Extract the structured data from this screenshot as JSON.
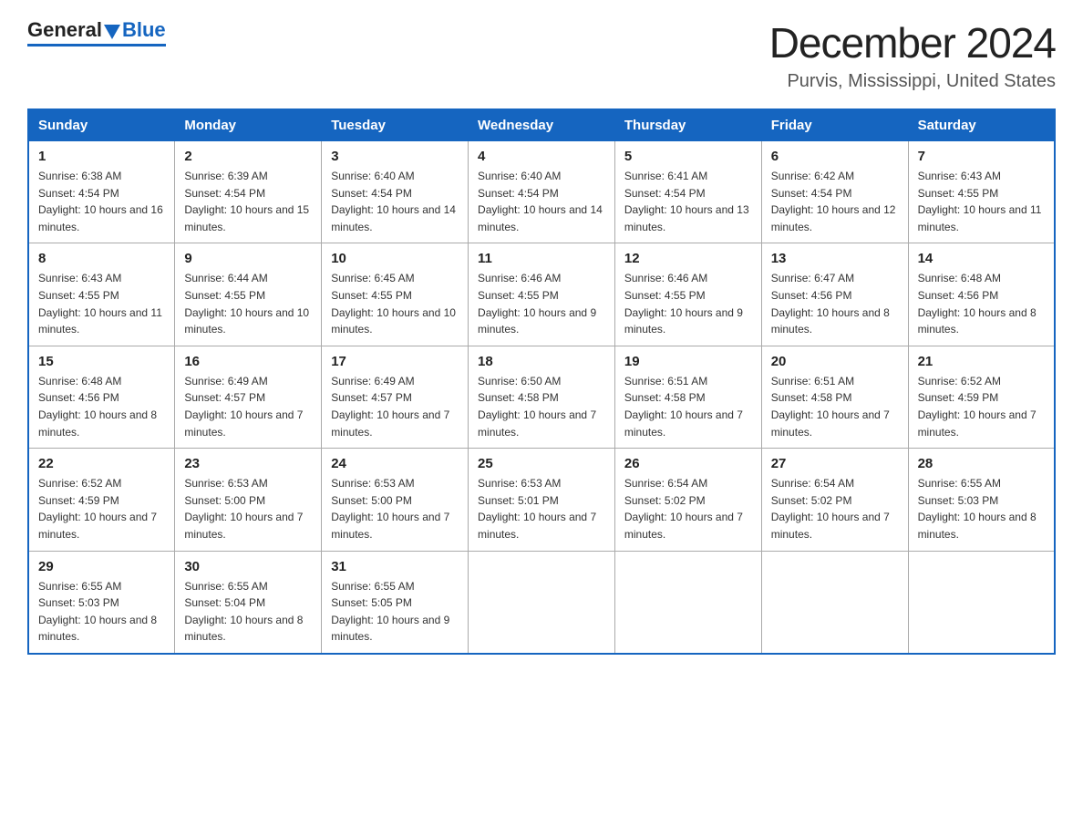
{
  "header": {
    "logo_general": "General",
    "logo_blue": "Blue",
    "month_title": "December 2024",
    "location": "Purvis, Mississippi, United States"
  },
  "days_of_week": [
    "Sunday",
    "Monday",
    "Tuesday",
    "Wednesday",
    "Thursday",
    "Friday",
    "Saturday"
  ],
  "weeks": [
    [
      {
        "day": "1",
        "sunrise": "6:38 AM",
        "sunset": "4:54 PM",
        "daylight": "10 hours and 16 minutes."
      },
      {
        "day": "2",
        "sunrise": "6:39 AM",
        "sunset": "4:54 PM",
        "daylight": "10 hours and 15 minutes."
      },
      {
        "day": "3",
        "sunrise": "6:40 AM",
        "sunset": "4:54 PM",
        "daylight": "10 hours and 14 minutes."
      },
      {
        "day": "4",
        "sunrise": "6:40 AM",
        "sunset": "4:54 PM",
        "daylight": "10 hours and 14 minutes."
      },
      {
        "day": "5",
        "sunrise": "6:41 AM",
        "sunset": "4:54 PM",
        "daylight": "10 hours and 13 minutes."
      },
      {
        "day": "6",
        "sunrise": "6:42 AM",
        "sunset": "4:54 PM",
        "daylight": "10 hours and 12 minutes."
      },
      {
        "day": "7",
        "sunrise": "6:43 AM",
        "sunset": "4:55 PM",
        "daylight": "10 hours and 11 minutes."
      }
    ],
    [
      {
        "day": "8",
        "sunrise": "6:43 AM",
        "sunset": "4:55 PM",
        "daylight": "10 hours and 11 minutes."
      },
      {
        "day": "9",
        "sunrise": "6:44 AM",
        "sunset": "4:55 PM",
        "daylight": "10 hours and 10 minutes."
      },
      {
        "day": "10",
        "sunrise": "6:45 AM",
        "sunset": "4:55 PM",
        "daylight": "10 hours and 10 minutes."
      },
      {
        "day": "11",
        "sunrise": "6:46 AM",
        "sunset": "4:55 PM",
        "daylight": "10 hours and 9 minutes."
      },
      {
        "day": "12",
        "sunrise": "6:46 AM",
        "sunset": "4:55 PM",
        "daylight": "10 hours and 9 minutes."
      },
      {
        "day": "13",
        "sunrise": "6:47 AM",
        "sunset": "4:56 PM",
        "daylight": "10 hours and 8 minutes."
      },
      {
        "day": "14",
        "sunrise": "6:48 AM",
        "sunset": "4:56 PM",
        "daylight": "10 hours and 8 minutes."
      }
    ],
    [
      {
        "day": "15",
        "sunrise": "6:48 AM",
        "sunset": "4:56 PM",
        "daylight": "10 hours and 8 minutes."
      },
      {
        "day": "16",
        "sunrise": "6:49 AM",
        "sunset": "4:57 PM",
        "daylight": "10 hours and 7 minutes."
      },
      {
        "day": "17",
        "sunrise": "6:49 AM",
        "sunset": "4:57 PM",
        "daylight": "10 hours and 7 minutes."
      },
      {
        "day": "18",
        "sunrise": "6:50 AM",
        "sunset": "4:58 PM",
        "daylight": "10 hours and 7 minutes."
      },
      {
        "day": "19",
        "sunrise": "6:51 AM",
        "sunset": "4:58 PM",
        "daylight": "10 hours and 7 minutes."
      },
      {
        "day": "20",
        "sunrise": "6:51 AM",
        "sunset": "4:58 PM",
        "daylight": "10 hours and 7 minutes."
      },
      {
        "day": "21",
        "sunrise": "6:52 AM",
        "sunset": "4:59 PM",
        "daylight": "10 hours and 7 minutes."
      }
    ],
    [
      {
        "day": "22",
        "sunrise": "6:52 AM",
        "sunset": "4:59 PM",
        "daylight": "10 hours and 7 minutes."
      },
      {
        "day": "23",
        "sunrise": "6:53 AM",
        "sunset": "5:00 PM",
        "daylight": "10 hours and 7 minutes."
      },
      {
        "day": "24",
        "sunrise": "6:53 AM",
        "sunset": "5:00 PM",
        "daylight": "10 hours and 7 minutes."
      },
      {
        "day": "25",
        "sunrise": "6:53 AM",
        "sunset": "5:01 PM",
        "daylight": "10 hours and 7 minutes."
      },
      {
        "day": "26",
        "sunrise": "6:54 AM",
        "sunset": "5:02 PM",
        "daylight": "10 hours and 7 minutes."
      },
      {
        "day": "27",
        "sunrise": "6:54 AM",
        "sunset": "5:02 PM",
        "daylight": "10 hours and 7 minutes."
      },
      {
        "day": "28",
        "sunrise": "6:55 AM",
        "sunset": "5:03 PM",
        "daylight": "10 hours and 8 minutes."
      }
    ],
    [
      {
        "day": "29",
        "sunrise": "6:55 AM",
        "sunset": "5:03 PM",
        "daylight": "10 hours and 8 minutes."
      },
      {
        "day": "30",
        "sunrise": "6:55 AM",
        "sunset": "5:04 PM",
        "daylight": "10 hours and 8 minutes."
      },
      {
        "day": "31",
        "sunrise": "6:55 AM",
        "sunset": "5:05 PM",
        "daylight": "10 hours and 9 minutes."
      },
      null,
      null,
      null,
      null
    ]
  ]
}
